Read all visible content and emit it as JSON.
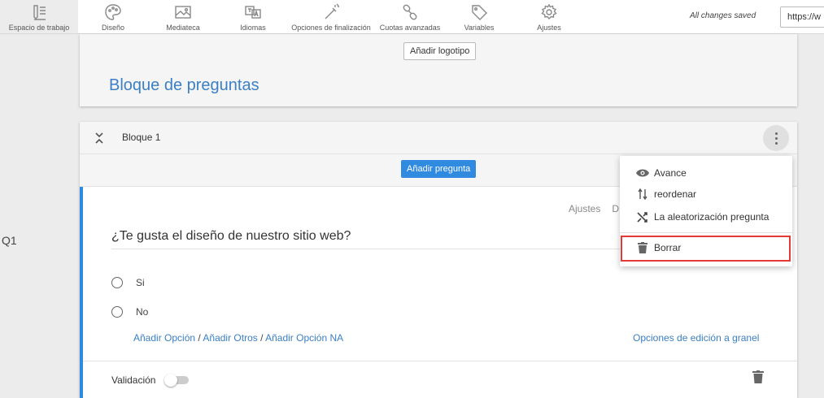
{
  "toolbar": {
    "items": [
      {
        "label": "Espacio de trabajo",
        "icon": "workspace-icon"
      },
      {
        "label": "Diseño",
        "icon": "palette-icon"
      },
      {
        "label": "Mediateca",
        "icon": "image-icon"
      },
      {
        "label": "Idiomas",
        "icon": "language-icon"
      },
      {
        "label": "Opciones de finalización",
        "icon": "magic-wand-icon"
      },
      {
        "label": "Cuotas avanzadas",
        "icon": "link-icon"
      },
      {
        "label": "Variables",
        "icon": "tag-icon"
      },
      {
        "label": "Ajustes",
        "icon": "gear-icon"
      }
    ],
    "status": "All changes saved",
    "url_value": "https://w"
  },
  "header": {
    "logo_button": "Añadir logotipo",
    "title": "Bloque de preguntas"
  },
  "block": {
    "name": "Bloque 1",
    "add_question": "Añadir pregunta"
  },
  "question": {
    "number": "Q1",
    "tabs": [
      "Ajustes",
      "D"
    ],
    "text": "¿Te gusta el diseño de nuestro sitio web?",
    "choices": [
      "Si",
      "No"
    ],
    "add_option": "Añadir Opción",
    "add_other": "Añadir Otros",
    "add_na": "Añadir Opción NA",
    "separator": " / ",
    "bulk_edit": "Opciones de edición a granel",
    "validation_label": "Validación"
  },
  "menu": {
    "items": [
      {
        "label": "Avance",
        "icon": "eye-icon"
      },
      {
        "label": "reordenar",
        "icon": "reorder-icon"
      },
      {
        "label": "La aleatorización pregunta",
        "icon": "shuffle-icon"
      },
      {
        "label": "Borrar",
        "icon": "trash-icon"
      }
    ]
  },
  "colors": {
    "accent": "#2f8ae0",
    "title": "#3b7fc4",
    "highlight": "#e53935"
  }
}
